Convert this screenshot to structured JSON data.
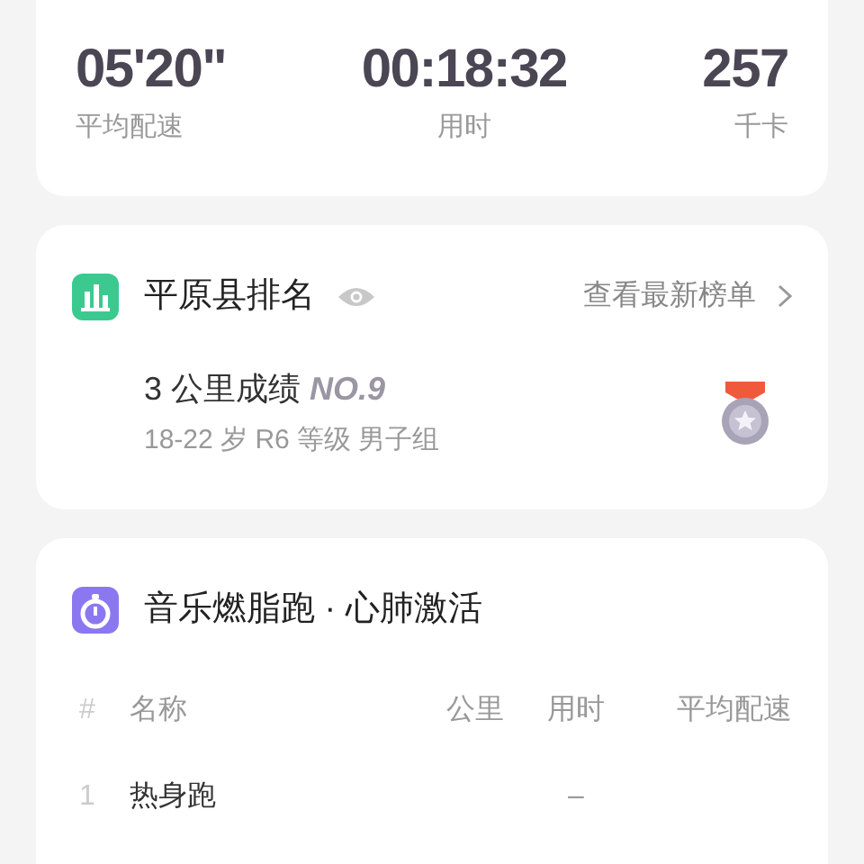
{
  "summary": {
    "stats": [
      {
        "value": "05'20\"",
        "label": "平均配速"
      },
      {
        "value": "00:18:32",
        "label": "用时"
      },
      {
        "value": "257",
        "label": "千卡"
      }
    ]
  },
  "ranking": {
    "title": "平原县排名",
    "link": "查看最新榜单",
    "result": "3 公里成绩 ",
    "rank": "NO.9",
    "group": "18-22 岁 R6 等级 男子组"
  },
  "workout": {
    "title": "音乐燃脂跑 · 心肺激活",
    "columns": [
      "#",
      "名称",
      "公里",
      "用时",
      "平均配速"
    ],
    "rows": [
      {
        "index": "1",
        "name": "热身跑",
        "time": "–"
      }
    ]
  }
}
